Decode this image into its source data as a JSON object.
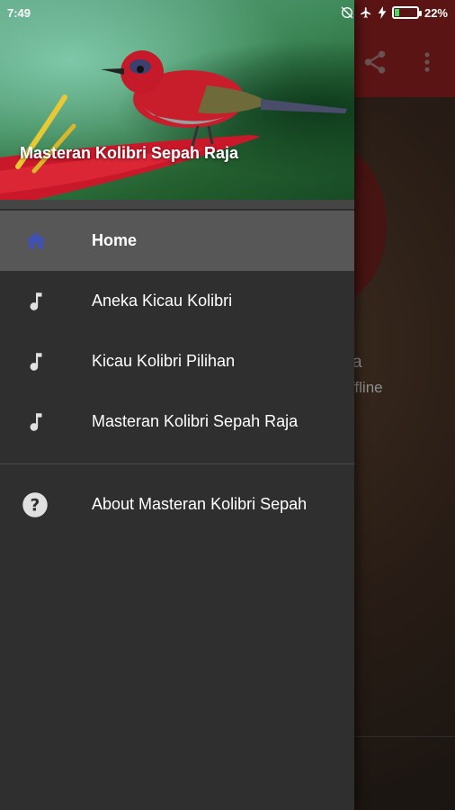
{
  "status_bar": {
    "time": "7:49",
    "battery_percent": "22%",
    "battery_level": 0.22,
    "icons": [
      "sync-off-icon",
      "airplane-mode-icon",
      "charging-bolt-icon",
      "battery-icon"
    ]
  },
  "drawer": {
    "header": {
      "title": "Masteran Kolibri Sepah Raja"
    },
    "items": [
      {
        "label": "Home",
        "icon": "home-icon",
        "selected": true
      },
      {
        "label": "Aneka Kicau Kolibri",
        "icon": "music-note-icon",
        "selected": false
      },
      {
        "label": "Kicau Kolibri Pilihan",
        "icon": "music-note-icon",
        "selected": false
      },
      {
        "label": "Masteran Kolibri Sepah Raja",
        "icon": "music-note-icon",
        "selected": false
      }
    ],
    "footer_items": [
      {
        "label": "About Masteran Kolibri Sepah",
        "icon": "help-circle-icon"
      }
    ]
  },
  "background": {
    "partial_text_1": "a",
    "partial_text_2": "ffline",
    "toolbar_icons": [
      "share-icon",
      "more-vert-icon"
    ]
  },
  "colors": {
    "drawer_bg": "#2f2f2f",
    "selected_item_bg": "#575757",
    "home_icon": "#3f51b5",
    "toolbar_bg": "#5a1414"
  }
}
